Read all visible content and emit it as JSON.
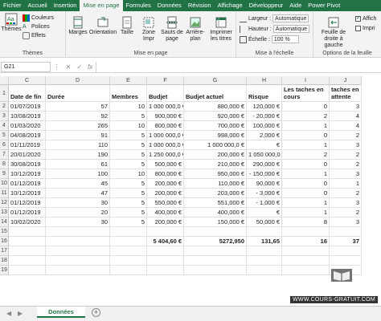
{
  "ribbon_tabs": [
    "Fichier",
    "Accueil",
    "Insertion",
    "Mise en page",
    "Formules",
    "Données",
    "Révision",
    "Affichage",
    "Développeur",
    "Aide",
    "Power Pivot"
  ],
  "active_tab": "Mise en page",
  "groups": {
    "themes": {
      "label": "Thèmes",
      "themes_button": "Thèmes",
      "colors": "Couleurs",
      "fonts": "Polices",
      "effects": "Effets"
    },
    "page_setup": {
      "label": "Mise en page",
      "margins": "Marges",
      "orientation": "Orientation",
      "size": "Taille",
      "print_area": "Zone Impr",
      "breaks": "Sauts de page",
      "background": "Arrière-plan",
      "print_titles": "Imprimer les titres"
    },
    "scale": {
      "label": "Mise à l'échelle",
      "width_label": "Largeur :",
      "width_value": "Automatique",
      "height_label": "Hauteur :",
      "height_value": "Automatique",
      "scale_label": "Échelle :",
      "scale_value": "100 %"
    },
    "sheet_options": {
      "label": "Options de la feuille",
      "rtl": "Feuille de droite à gauche",
      "grid_view": "Affich",
      "grid_print": "Impri"
    }
  },
  "formula_bar": {
    "name_box": "G21",
    "formula": ""
  },
  "columns": [
    "C",
    "D",
    "E",
    "F",
    "G",
    "H",
    "I",
    "J"
  ],
  "row_numbers": [
    "1",
    "2",
    "3",
    "4",
    "5",
    "6",
    "7",
    "8",
    "9",
    "10",
    "11",
    "12",
    "13",
    "14",
    "15",
    "16",
    "17",
    "18",
    "19"
  ],
  "headers": [
    "Date de fin",
    "Durée",
    "Membres",
    "Budjet",
    "Budjet actuel",
    "Risque",
    "Les taches en cours",
    "Les taches en attente"
  ],
  "rows": [
    [
      "01/07/2019",
      "57",
      "10",
      "1 000 000,0 €",
      "880,000 €",
      "120,000 €",
      "0",
      "3"
    ],
    [
      "10/08/2019",
      "92",
      "5",
      "900,000 €",
      "920,000 €",
      "-    20,000 €",
      "2",
      "4"
    ],
    [
      "01/03/2020",
      "265",
      "10",
      "800,000 €",
      "700,000 €",
      "100,000 €",
      "1",
      "4"
    ],
    [
      "04/08/2019",
      "91",
      "5",
      "1 000 000,0 €",
      "998,000 €",
      "2,000 €",
      "0",
      "2"
    ],
    [
      "01/11/2019",
      "110",
      "5",
      "1 000 000,0 €",
      "1 000 000,0 €",
      "€",
      "1",
      "3"
    ],
    [
      "20/01/2020",
      "190",
      "5",
      "1 250 000,0 €",
      "200,000 €",
      "1 050 000,0 €",
      "2",
      "2"
    ],
    [
      "30/08/2019",
      "61",
      "5",
      "500,000 €",
      "210,000 €",
      "290,000 €",
      "0",
      "2"
    ],
    [
      "10/12/2019",
      "100",
      "10",
      "800,000 €",
      "950,000 €",
      "-   150,000 €",
      "1",
      "3"
    ],
    [
      "01/12/2019",
      "45",
      "5",
      "200,000 €",
      "110,000 €",
      "90,000 €",
      "0",
      "1"
    ],
    [
      "10/12/2019",
      "47",
      "5",
      "200,000 €",
      "203,000 €",
      "-     3,000 €",
      "0",
      "2"
    ],
    [
      "01/12/2019",
      "30",
      "5",
      "550,000 €",
      "551,000 €",
      "-     1,000 €",
      "1",
      "3"
    ],
    [
      "01/12/2019",
      "20",
      "5",
      "400,000 €",
      "400,000 €",
      "€",
      "1",
      "2"
    ],
    [
      "10/02/2020",
      "30",
      "5",
      "200,000 €",
      "150,000 €",
      "50,000 €",
      "8",
      "3"
    ]
  ],
  "totals": [
    "",
    "",
    "",
    "5 404,60 €",
    "5272,950",
    "131,65",
    "16",
    "37"
  ],
  "sheet_tab": "Données",
  "watermark": "WWW.COURS-GRATUIT.COM",
  "colors": {
    "accent": "#217346"
  }
}
